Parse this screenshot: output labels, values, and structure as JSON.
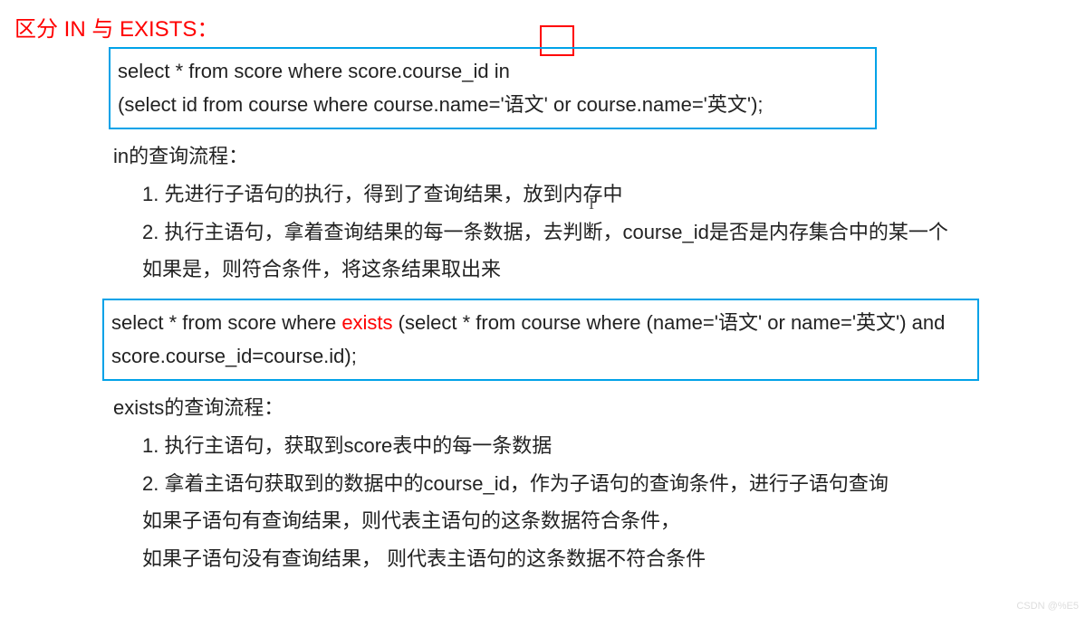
{
  "title": "区分 IN 与 EXISTS：",
  "code1_line1_a": "select * from score where score.course_id ",
  "code1_line1_b": "in",
  "code1_line2": "(select id from course where course.name='语文' or course.name='英文');",
  "in_heading": "in的查询流程：",
  "in_step1": "1. 先进行子语句的执行，得到了查询结果，放到内存中",
  "in_step2": "2. 执行主语句，拿着查询结果的每一条数据，去判断，course_id是否是内存集合中的某一个",
  "in_step3": "如果是，则符合条件，将这条结果取出来",
  "code2_a": "select * from score where ",
  "code2_kw": "exists",
  "code2_b": " (select * from course where (name='语文' or name='英文') and score.course_id=course.id);",
  "exists_heading": "exists的查询流程：",
  "exists_step1": "1. 执行主语句，获取到score表中的每一条数据",
  "exists_step2": "2. 拿着主语句获取到的数据中的course_id，作为子语句的查询条件，进行子语句查询",
  "exists_step3": "如果子语句有查询结果，则代表主语句的这条数据符合条件，",
  "exists_step4": "如果子语句没有查询结果， 则代表主语句的这条数据不符合条件",
  "watermark_small": "CSDN @%E5",
  "watermark_diag": ""
}
